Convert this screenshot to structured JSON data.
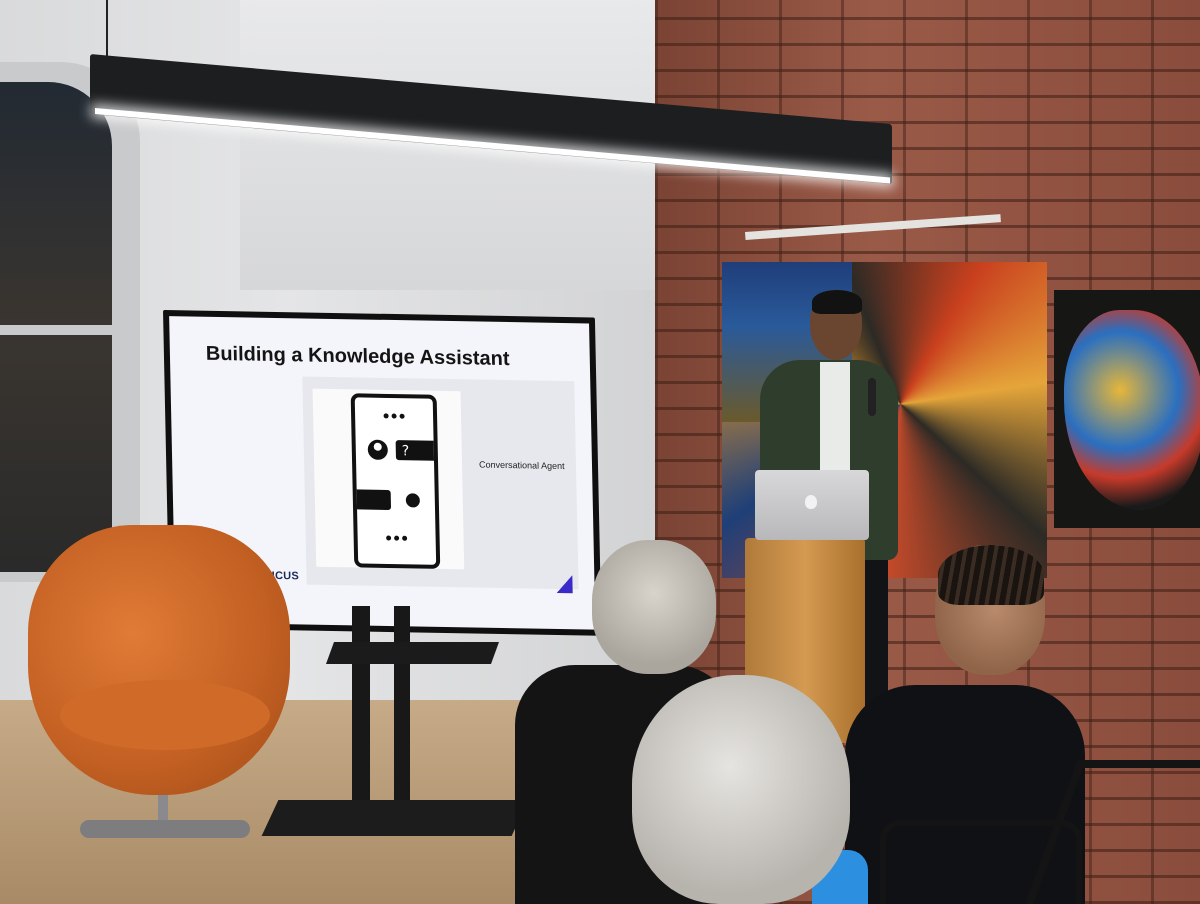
{
  "slide": {
    "title": "Building a Knowledge Assistant",
    "caption": "Conversational Agent",
    "brand": "PUBLICUS"
  },
  "colors": {
    "brick": "#8a4a3a",
    "chair_orange": "#d06a28",
    "slide_accent": "#3a2ac9",
    "brand_navy": "#1b2a5c"
  },
  "icons": [
    "phone-chat-icon",
    "publicus-logo-icon"
  ]
}
